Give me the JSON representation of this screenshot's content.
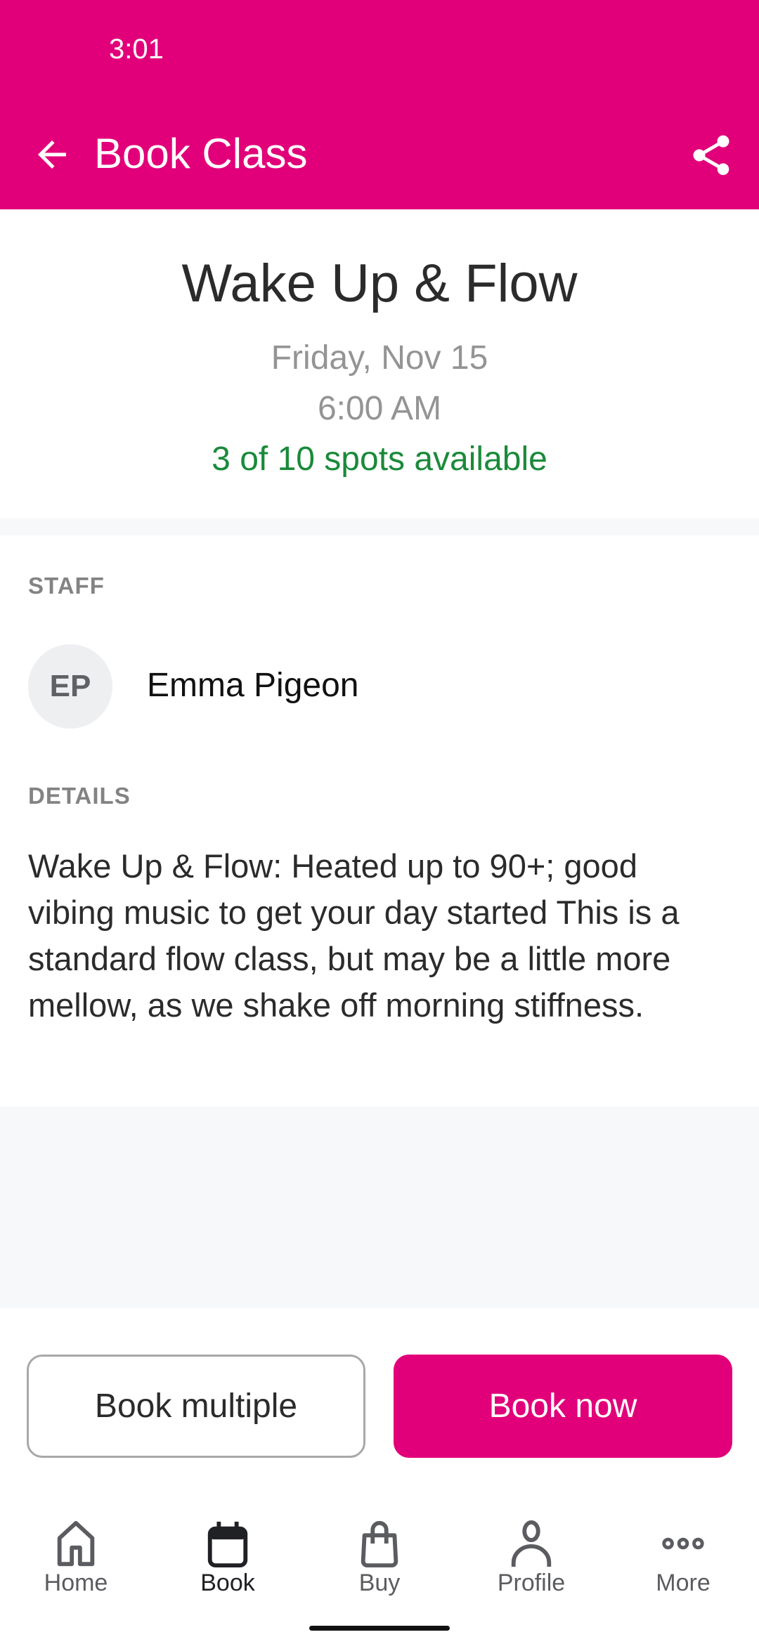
{
  "status_bar": {
    "time": "3:01"
  },
  "app_bar": {
    "title": "Book Class",
    "back_icon": "arrow-left-icon",
    "share_icon": "share-icon",
    "color": "#e2007a"
  },
  "class": {
    "title": "Wake Up & Flow",
    "date": "Friday, Nov 15",
    "time": "6:00 AM",
    "availability": "3 of 10 spots available",
    "spots_available": 3,
    "spots_total": 10,
    "availability_color": "#1a8a3a"
  },
  "staff": {
    "section_label": "STAFF",
    "initials": "EP",
    "name": "Emma Pigeon"
  },
  "details": {
    "section_label": "DETAILS",
    "description": "Wake Up & Flow: Heated up to 90+; good vibing music to get your day started This is a standard flow class, but may be a little more mellow, as we shake off morning stiffness."
  },
  "actions": {
    "book_multiple": "Book multiple",
    "book_now": "Book now"
  },
  "bottom_nav": {
    "items": [
      {
        "label": "Home",
        "icon": "home-icon",
        "active": false
      },
      {
        "label": "Book",
        "icon": "calendar-icon",
        "active": true
      },
      {
        "label": "Buy",
        "icon": "shopping-bag-icon",
        "active": false
      },
      {
        "label": "Profile",
        "icon": "person-icon",
        "active": false
      },
      {
        "label": "More",
        "icon": "more-dots-icon",
        "active": false
      }
    ]
  }
}
